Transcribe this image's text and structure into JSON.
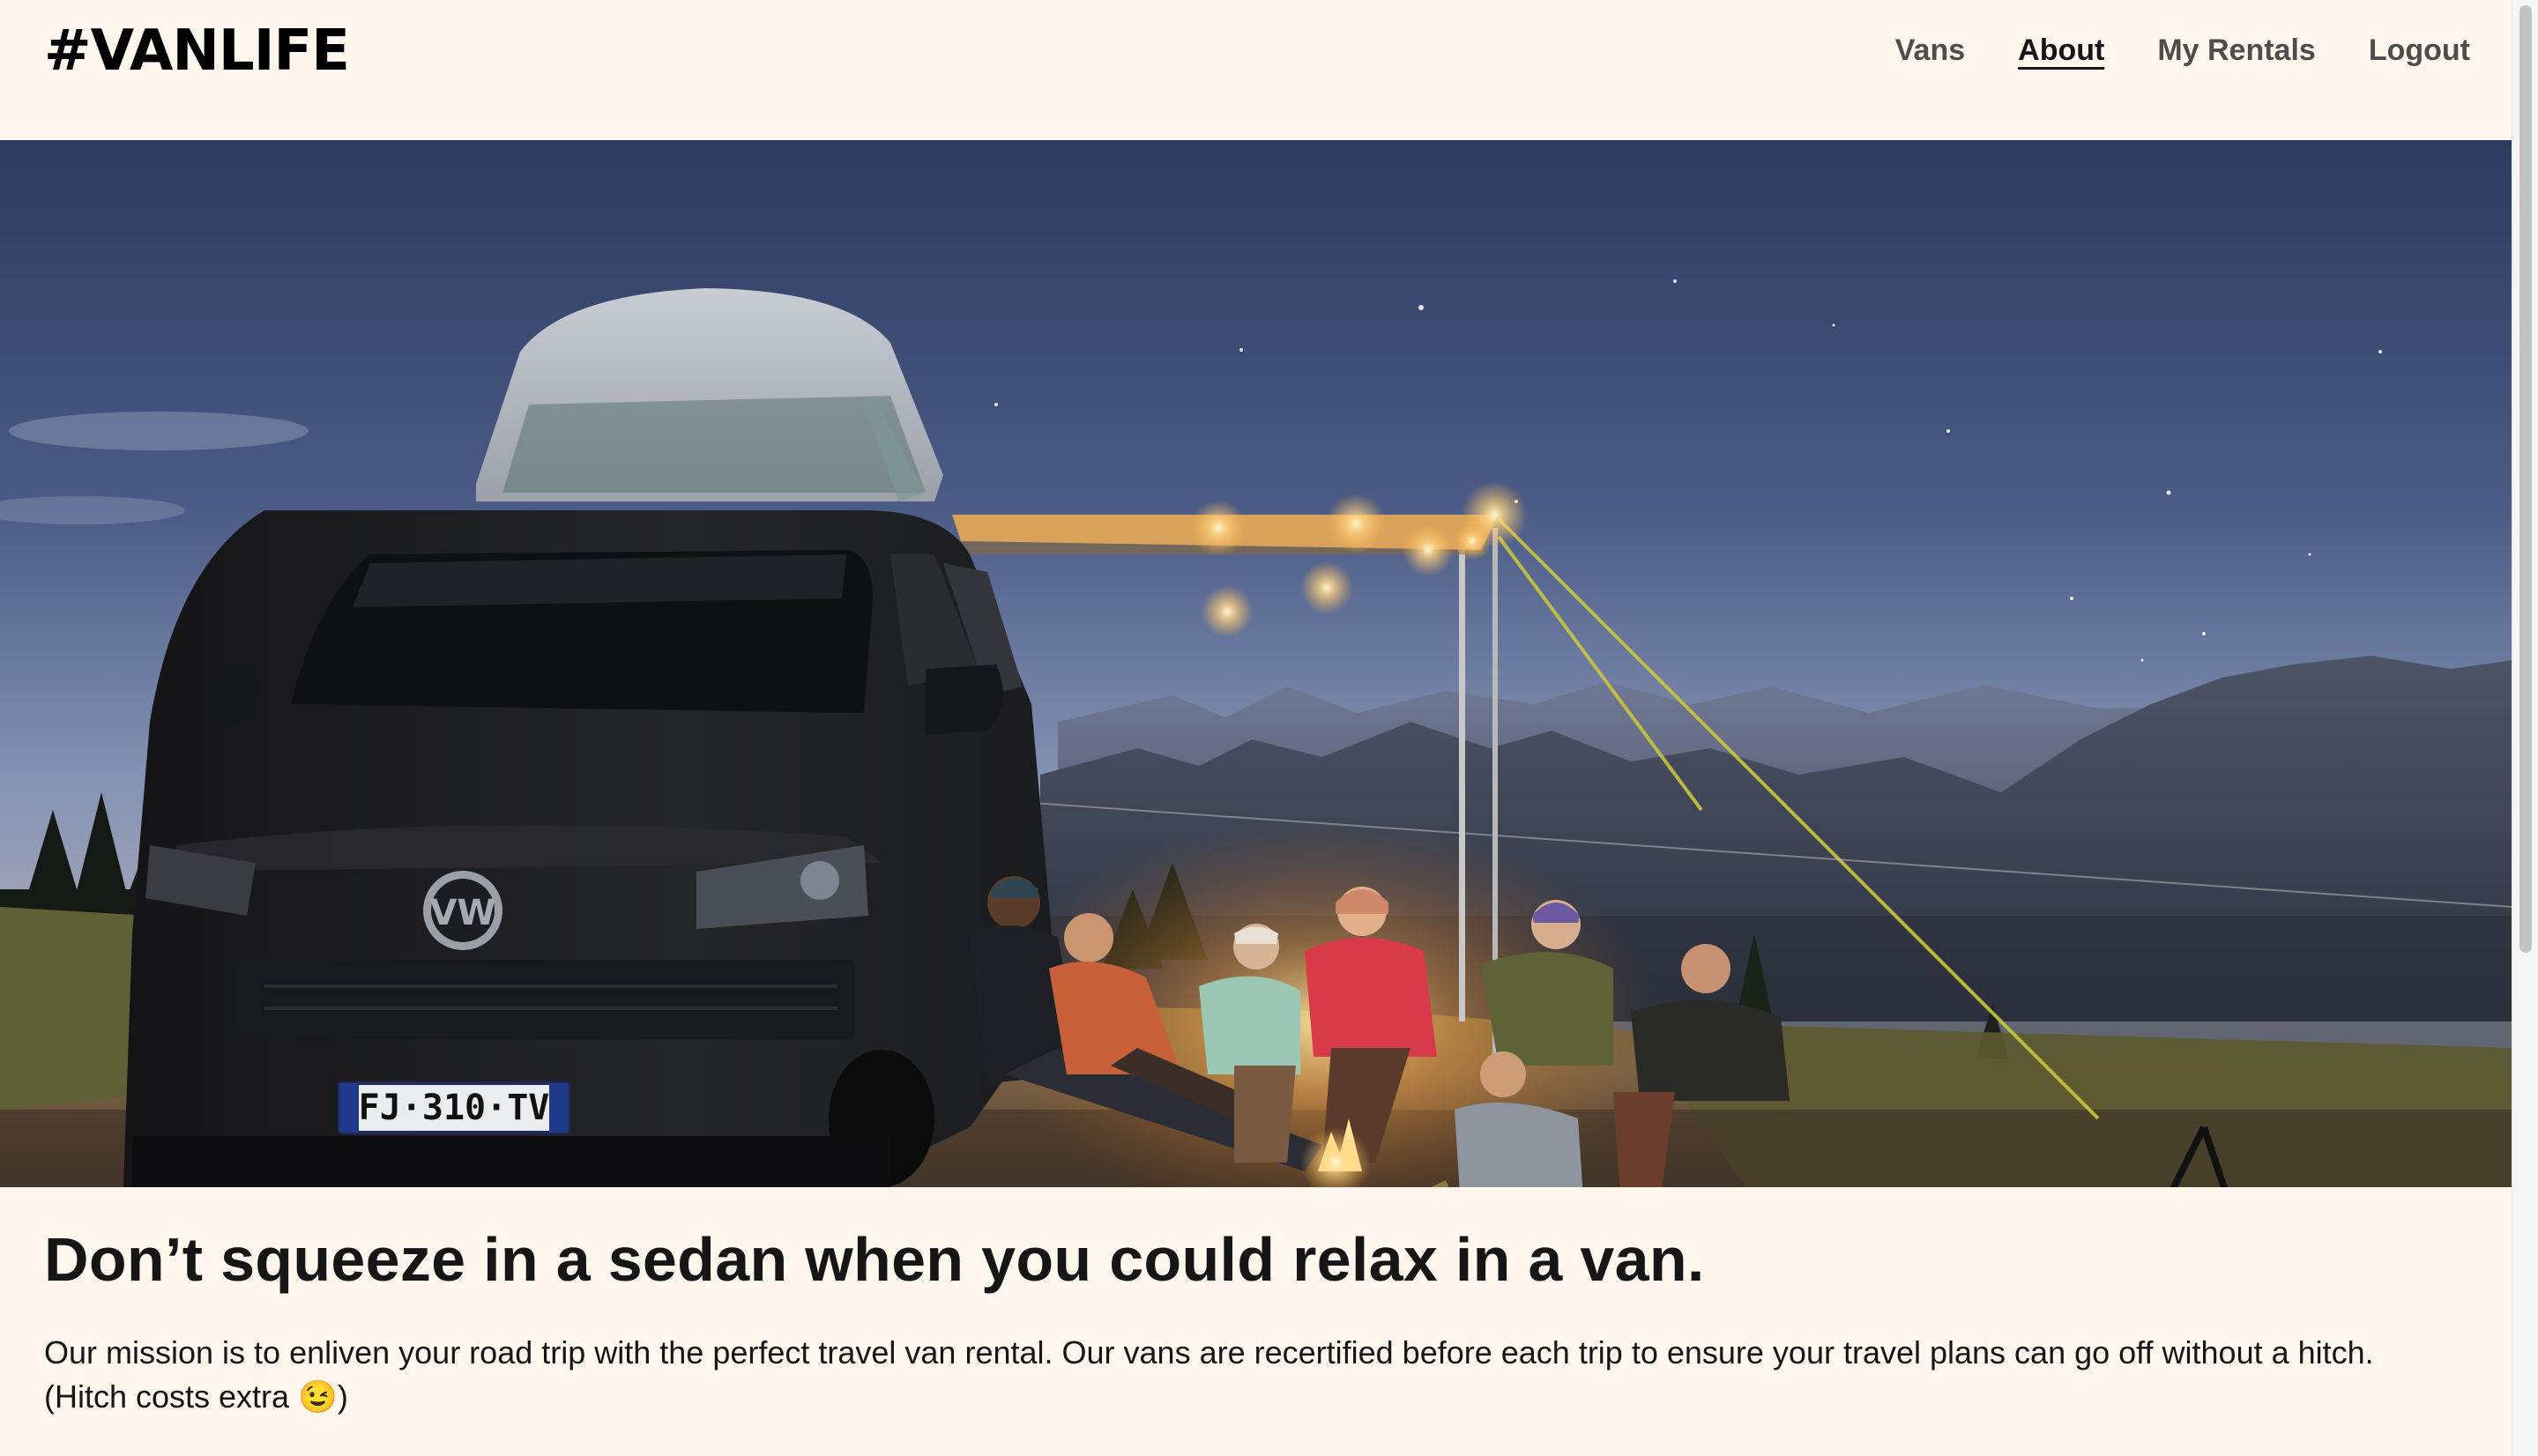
{
  "header": {
    "logo": "#VANLIFE",
    "nav": [
      {
        "label": "Vans",
        "active": false
      },
      {
        "label": "About",
        "active": true
      },
      {
        "label": "My Rentals",
        "active": false
      },
      {
        "label": "Logout",
        "active": false
      }
    ]
  },
  "hero": {
    "license_plate": "FJ·310·TV"
  },
  "content": {
    "headline": "Don’t squeeze in a sedan when you could relax in a van.",
    "mission": "Our mission is to enliven your road trip with the perfect travel van rental. Our vans are recertified before each trip to ensure your travel plans can go off without a hitch. (Hitch costs extra 😉)"
  },
  "colors": {
    "background": "#FFF7ED",
    "text": "#161616",
    "nav_text": "#4D4D4D"
  }
}
